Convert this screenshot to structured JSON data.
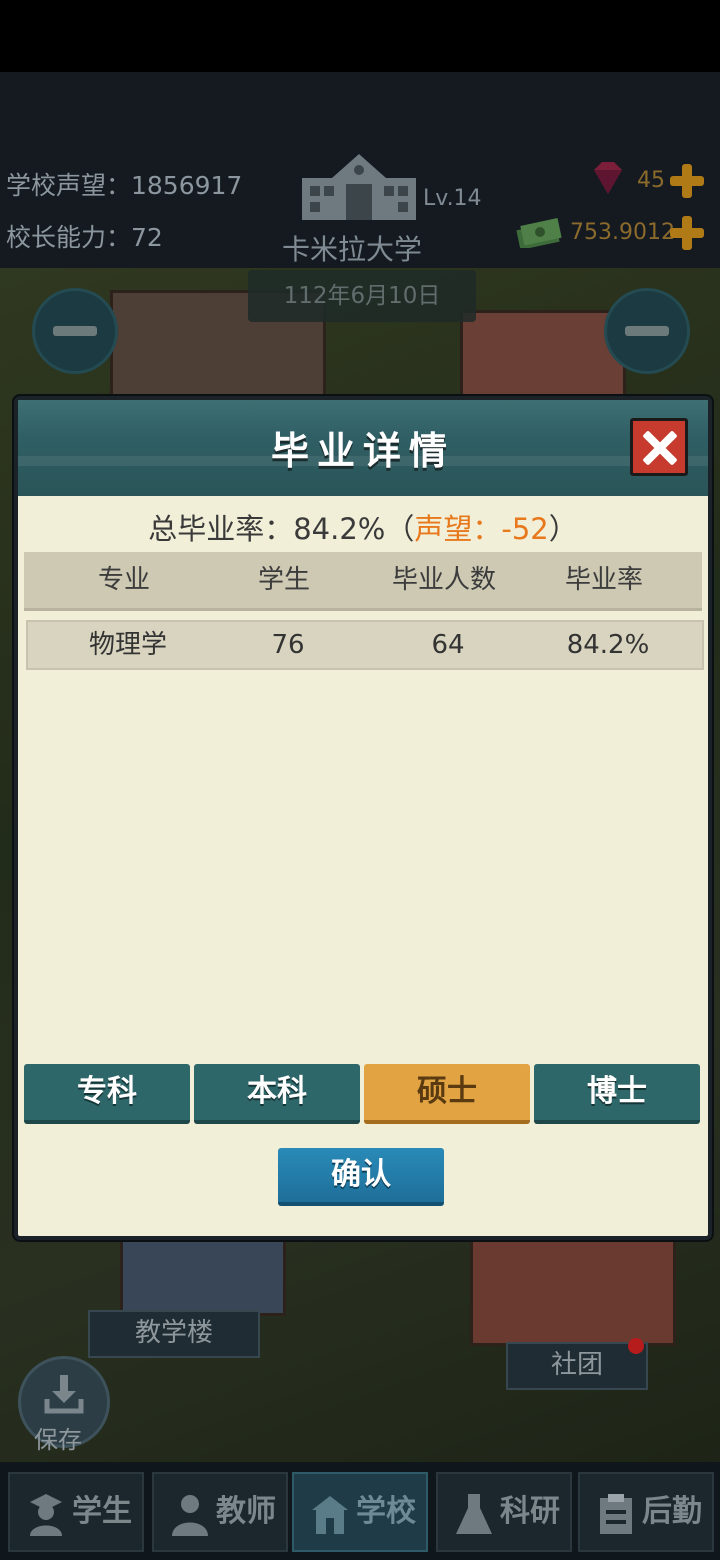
{
  "hud": {
    "reputation": "学校声望：1856917",
    "principal_ability": "校长能力：72",
    "level": "Lv.14",
    "school_name": "卡米拉大学",
    "date": "112年6月10日",
    "gems": "45",
    "money": "753.9012"
  },
  "dialog": {
    "title": "毕业详情",
    "summary_prefix": "总毕业率：84.2%（",
    "summary_reputation": "声望：-52",
    "summary_suffix": "）",
    "columns": [
      "专业",
      "学生",
      "毕业人数",
      "毕业率"
    ],
    "rows": [
      {
        "major": "物理学",
        "students": "76",
        "graduates": "64",
        "rate": "84.2%"
      }
    ],
    "tabs": [
      "专科",
      "本科",
      "硕士",
      "博士"
    ],
    "active_tab": "硕士",
    "confirm": "确认"
  },
  "map": {
    "teaching_building": "教学楼",
    "club": "社团",
    "save": "保存"
  },
  "nav": {
    "tabs": [
      "学生",
      "教师",
      "学校",
      "科研",
      "后勤"
    ],
    "active": "学校"
  },
  "colors": {
    "accent_orange": "#e8781c",
    "tab_active": "#e2a443",
    "confirm_blue": "#2a8ab8",
    "close_red": "#c63b2e"
  }
}
